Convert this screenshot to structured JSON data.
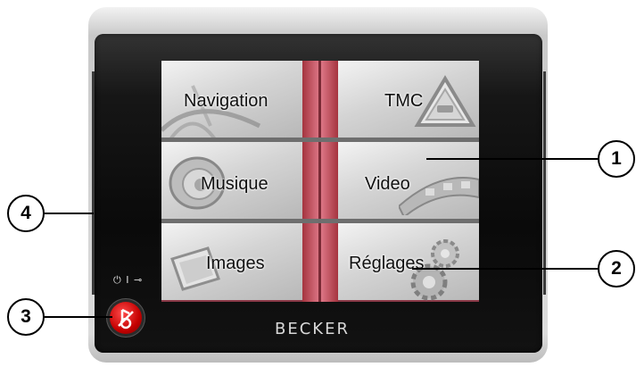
{
  "menu": {
    "navigation": "Navigation",
    "tmc": "TMC",
    "musique": "Musique",
    "video": "Video",
    "images": "Images",
    "reglages": "Réglages"
  },
  "device": {
    "brand": "BECKER",
    "power_symbol": "⏻ I ⊸"
  },
  "callouts": [
    "1",
    "2",
    "3",
    "4"
  ],
  "colors": {
    "divider": "#c8485a",
    "power_button": "#d00000"
  }
}
